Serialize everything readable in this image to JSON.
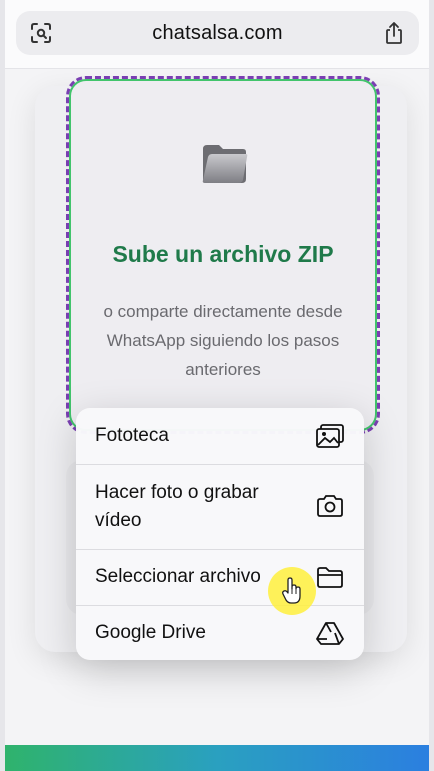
{
  "browser": {
    "url": "chatsalsa.com",
    "scan_icon": "scan-icon",
    "share_icon": "share-icon"
  },
  "upload": {
    "icon": "folder-icon",
    "title": "Sube un archivo ZIP",
    "description": "o comparte directamente desde WhatsApp siguiendo los pasos anteriores"
  },
  "menu": {
    "items": [
      {
        "label": "Fototeca",
        "icon": "photo-library-icon"
      },
      {
        "label": "Hacer foto o grabar vídeo",
        "icon": "camera-icon"
      },
      {
        "label": "Seleccionar archivo",
        "icon": "folder-icon"
      },
      {
        "label": "Google Drive",
        "icon": "google-drive-icon"
      }
    ]
  },
  "colors": {
    "title_green": "#1f7a4a",
    "dash_purple": "#7a3fb2",
    "dash_green": "#42c46c",
    "cursor_highlight": "#fff03c"
  }
}
